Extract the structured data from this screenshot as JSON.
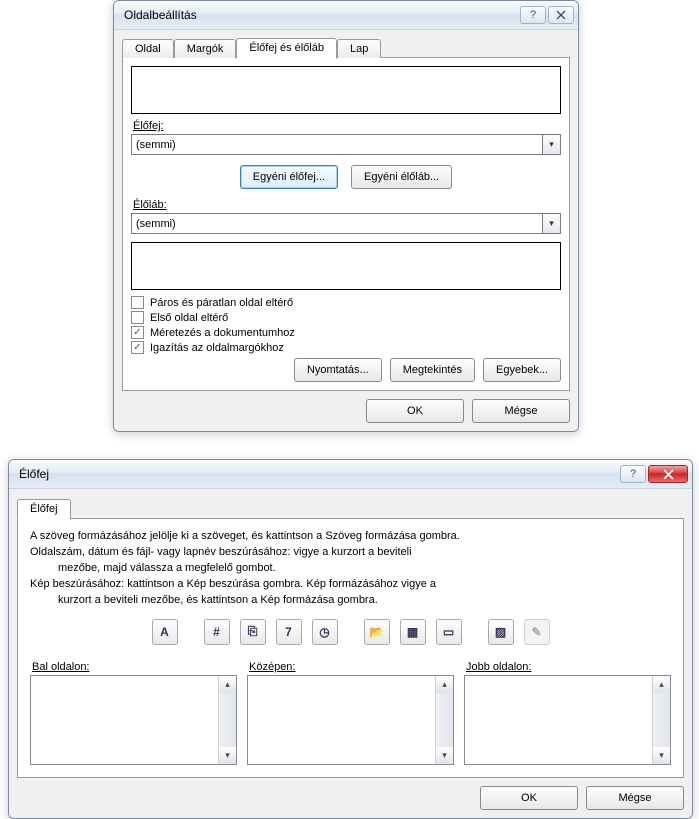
{
  "dialog1": {
    "title": "Oldalbeállítás",
    "tabs": [
      "Oldal",
      "Margók",
      "Élőfej és élőláb",
      "Lap"
    ],
    "header_label": "Élőfej:",
    "header_value": "(semmi)",
    "btn_custom_header": "Egyéni élőfej...",
    "btn_custom_footer": "Egyéni élőláb...",
    "footer_label": "Élőláb:",
    "footer_value": "(semmi)",
    "checks": [
      {
        "label": "Páros és páratlan oldal eltérő",
        "checked": false
      },
      {
        "label": "Első oldal eltérő",
        "checked": false
      },
      {
        "label": "Méretezés a dokumentumhoz",
        "checked": true
      },
      {
        "label": "Igazítás az oldalmargókhoz",
        "checked": true
      }
    ],
    "btn_print": "Nyomtatás...",
    "btn_preview": "Megtekintés",
    "btn_other": "Egyebek...",
    "btn_ok": "OK",
    "btn_cancel": "Mégse"
  },
  "dialog2": {
    "title": "Élőfej",
    "tab": "Élőfej",
    "help_line1": "A szöveg formázásához jelölje ki a szöveget, és kattintson a Szöveg formázása gombra.",
    "help_line2a": "Oldalszám, dátum és fájl- vagy lapnév beszúrásához: vigye a kurzort a beviteli",
    "help_line2b": "mezőbe, majd válassza a megfelelő gombot.",
    "help_line3a": "Kép beszúrásához: kattintson a Kép beszúrása gombra. Kép formázásához vigye a",
    "help_line3b": "kurzort a beviteli mezőbe, és kattintson a Kép formázása gombra.",
    "icons": [
      {
        "name": "format-text-icon",
        "glyph": "A"
      },
      {
        "name": "page-number-icon",
        "glyph": "#"
      },
      {
        "name": "pages-icon",
        "glyph": "⎘"
      },
      {
        "name": "date-icon",
        "glyph": "7"
      },
      {
        "name": "time-icon",
        "glyph": "◷"
      },
      {
        "name": "file-path-icon",
        "glyph": "📂"
      },
      {
        "name": "file-name-icon",
        "glyph": "▦"
      },
      {
        "name": "sheet-name-icon",
        "glyph": "▭"
      },
      {
        "name": "insert-picture-icon",
        "glyph": "▨"
      },
      {
        "name": "format-picture-icon",
        "glyph": "✎",
        "disabled": true
      }
    ],
    "left_label": "Bal oldalon:",
    "center_label": "Középen:",
    "right_label": "Jobb oldalon:",
    "btn_ok": "OK",
    "btn_cancel": "Mégse"
  }
}
